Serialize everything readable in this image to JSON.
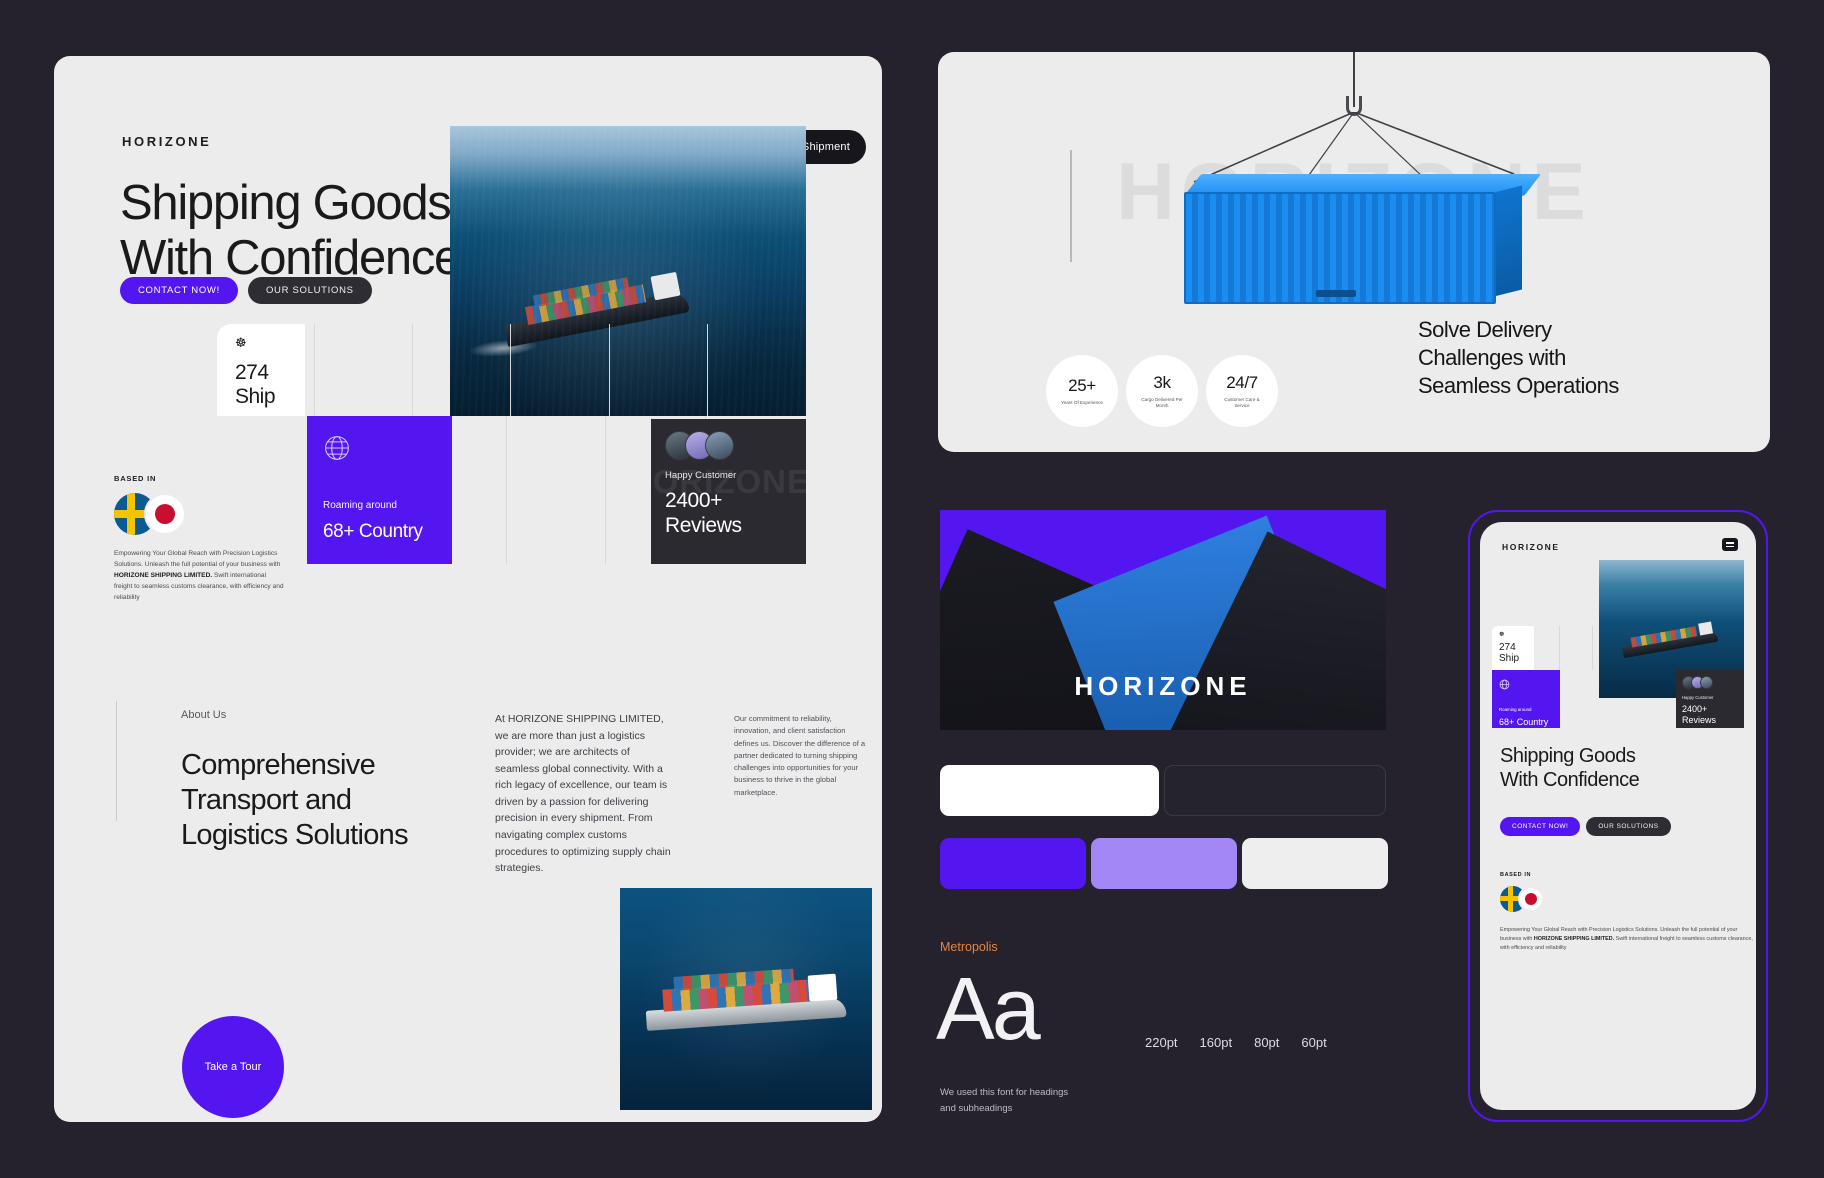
{
  "brand": {
    "name": "HORIZONE",
    "accent": "#5416f0",
    "accent_light": "#a387f7",
    "dark": "#25242d",
    "light": "#ececec",
    "type_accent": "#e8833f"
  },
  "hero": {
    "logo": "HORIZONE",
    "nav_button": "Book Shipment",
    "headline": "Shipping Goods\nWith Confidence",
    "cta_primary": "CONTACT NOW!",
    "cta_secondary": "OUR SOLUTIONS",
    "ship_card": {
      "icon": "ship-wheel-icon",
      "value": "274",
      "label": "Ship"
    },
    "country_card": {
      "icon": "globe-icon",
      "caption": "Roaming around",
      "value": "68+ Country"
    },
    "reviews_card": {
      "caption": "Happy Customer",
      "value": "2400+\nReviews",
      "ghost": "HORIZONE"
    },
    "based_in": {
      "label": "BASED IN",
      "flags": [
        "sweden-flag",
        "japan-flag"
      ],
      "paragraph_start": "Empowering Your Global Reach with Precision Logistics Solutions. Unleash the full potential of your business with ",
      "paragraph_bold": "HORIZONE SHIPPING LIMITED.",
      "paragraph_end": " Swift international freight to seamless customs clearance, with efficiency and reliability"
    }
  },
  "about": {
    "label": "About Us",
    "heading": "Comprehensive\nTransport and\nLogistics Solutions",
    "column_1": "At HORIZONE SHIPPING LIMITED, we are more than just a logistics provider; we are architects of seamless global connectivity. With a rich legacy of excellence, our team is driven by a passion for delivering precision in every shipment. From navigating complex customs procedures to optimizing supply chain strategies.",
    "column_2": "Our commitment to reliability, innovation, and client satisfaction defines us. Discover the difference of a partner dedicated to turning shipping challenges into opportunities for your business to thrive in the global marketplace.",
    "tour_button": "Take a Tour"
  },
  "hoist_panel": {
    "ghost_word": "HORIZONE",
    "stats": [
      {
        "value": "25+",
        "label": "Years Of Experience"
      },
      {
        "value": "3k",
        "label": "Cargo Delivered Per\nMonth"
      },
      {
        "value": "24/7",
        "label": "Customer Care &\nService"
      }
    ],
    "heading": "Solve Delivery\nChallenges with\nSeamless Operations"
  },
  "brand_image": {
    "watermark": "HORIZONE"
  },
  "palette": {
    "row_1": [
      "#ffffff",
      "#25242d"
    ],
    "row_2": [
      "#5416f0",
      "#a387f7",
      "#eeeeee"
    ]
  },
  "typography": {
    "font_name": "Metropolis",
    "sample": "Aa",
    "sizes": [
      "220pt",
      "160pt",
      "80pt",
      "60pt"
    ],
    "note": "We used this font for headings\nand subheadings"
  },
  "phone": {
    "logo": "HORIZONE",
    "ship_card": {
      "value": "274",
      "label": "Ship"
    },
    "country_card": {
      "caption": "Roaming around",
      "value": "68+ Country"
    },
    "reviews_card": {
      "caption": "Happy Customer",
      "value": "2400+\nReviews"
    },
    "headline": "Shipping Goods\nWith Confidence",
    "cta_primary": "CONTACT NOW!",
    "cta_secondary": "OUR SOLUTIONS",
    "based_label": "BASED IN",
    "copy_start": "Empowering Your Global Reach with Precision Logistics Solutions. Unleash the full potential of your business with ",
    "copy_bold": "HORIZONE SHIPPING LIMITED.",
    "copy_end": " Swift international freight to seamless customs clearance, with efficiency and reliability"
  }
}
